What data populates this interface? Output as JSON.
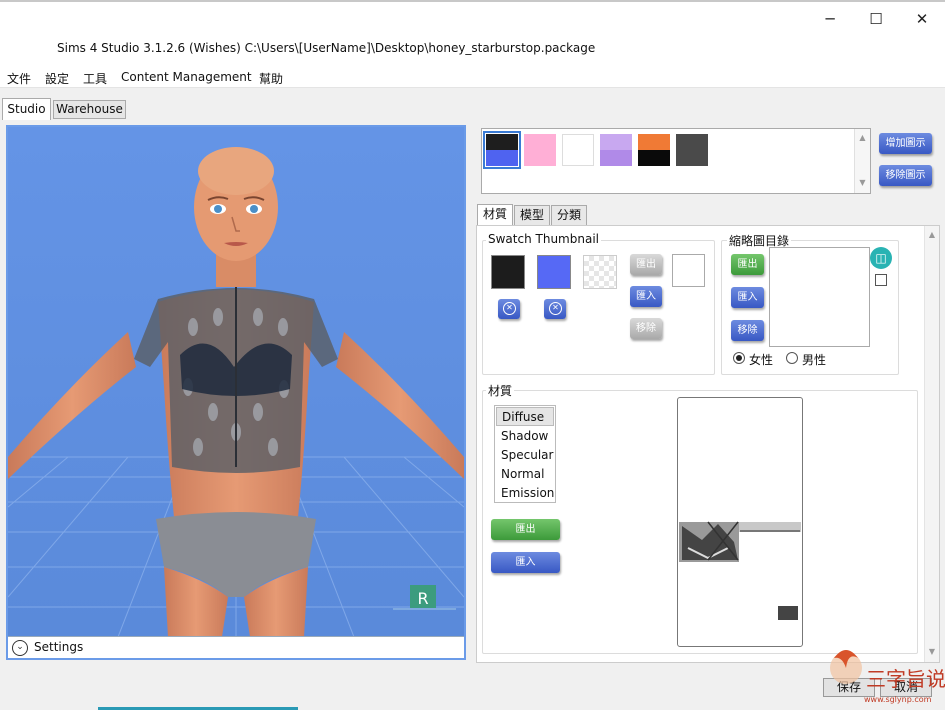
{
  "window": {
    "title": "Sims 4 Studio 3.1.2.6 (Wishes)  C:\\Users\\[UserName]\\Desktop\\honey_starburstop.package",
    "minimize": "─",
    "maximize": "☐",
    "close": "✕"
  },
  "menu": [
    "文件",
    "設定",
    "工具",
    "Content Management",
    "幫助"
  ],
  "main_tabs": [
    "Studio",
    "Warehouse"
  ],
  "viewport": {
    "settings_label": "Settings",
    "marker_letter": "R"
  },
  "swatches": {
    "colors": [
      {
        "top": "#1e1e1e",
        "bottom": "#4f63f0"
      },
      {
        "top": "#ffafd6",
        "bottom": "#ffafd6"
      },
      {
        "top": "#ffffff",
        "bottom": "#ffffff"
      },
      {
        "top": "#c8a8f0",
        "bottom": "#b08ae8"
      },
      {
        "top": "#f07a35",
        "bottom": "#0a0a0a"
      },
      {
        "top": "#4a4a4a",
        "bottom": "#4a4a4a"
      }
    ],
    "add_label": "增加圖示",
    "remove_label": "移除圖示"
  },
  "sub_tabs": [
    "材質",
    "模型",
    "分類"
  ],
  "swatch_thumbnail": {
    "title": "Swatch Thumbnail",
    "export_label": "匯出",
    "import_label": "匯入",
    "remove_label": "移除",
    "colors": [
      "#1c1c1c",
      "#5669f5"
    ]
  },
  "thumbnail_dir": {
    "title": "縮略圖目錄",
    "export_label": "匯出",
    "import_label": "匯入",
    "remove_label": "移除",
    "female_label": "女性",
    "male_label": "男性"
  },
  "material": {
    "title": "材質",
    "items": [
      "Diffuse",
      "Shadow",
      "Specular",
      "Normal",
      "Emission"
    ],
    "selected": "Diffuse",
    "export_label": "匯出",
    "import_label": "匯入"
  },
  "footer": {
    "save_label": "保存",
    "cancel_label": "取消"
  },
  "watermark": {
    "text": "三字旨说",
    "url": "www.sglynp.com"
  }
}
